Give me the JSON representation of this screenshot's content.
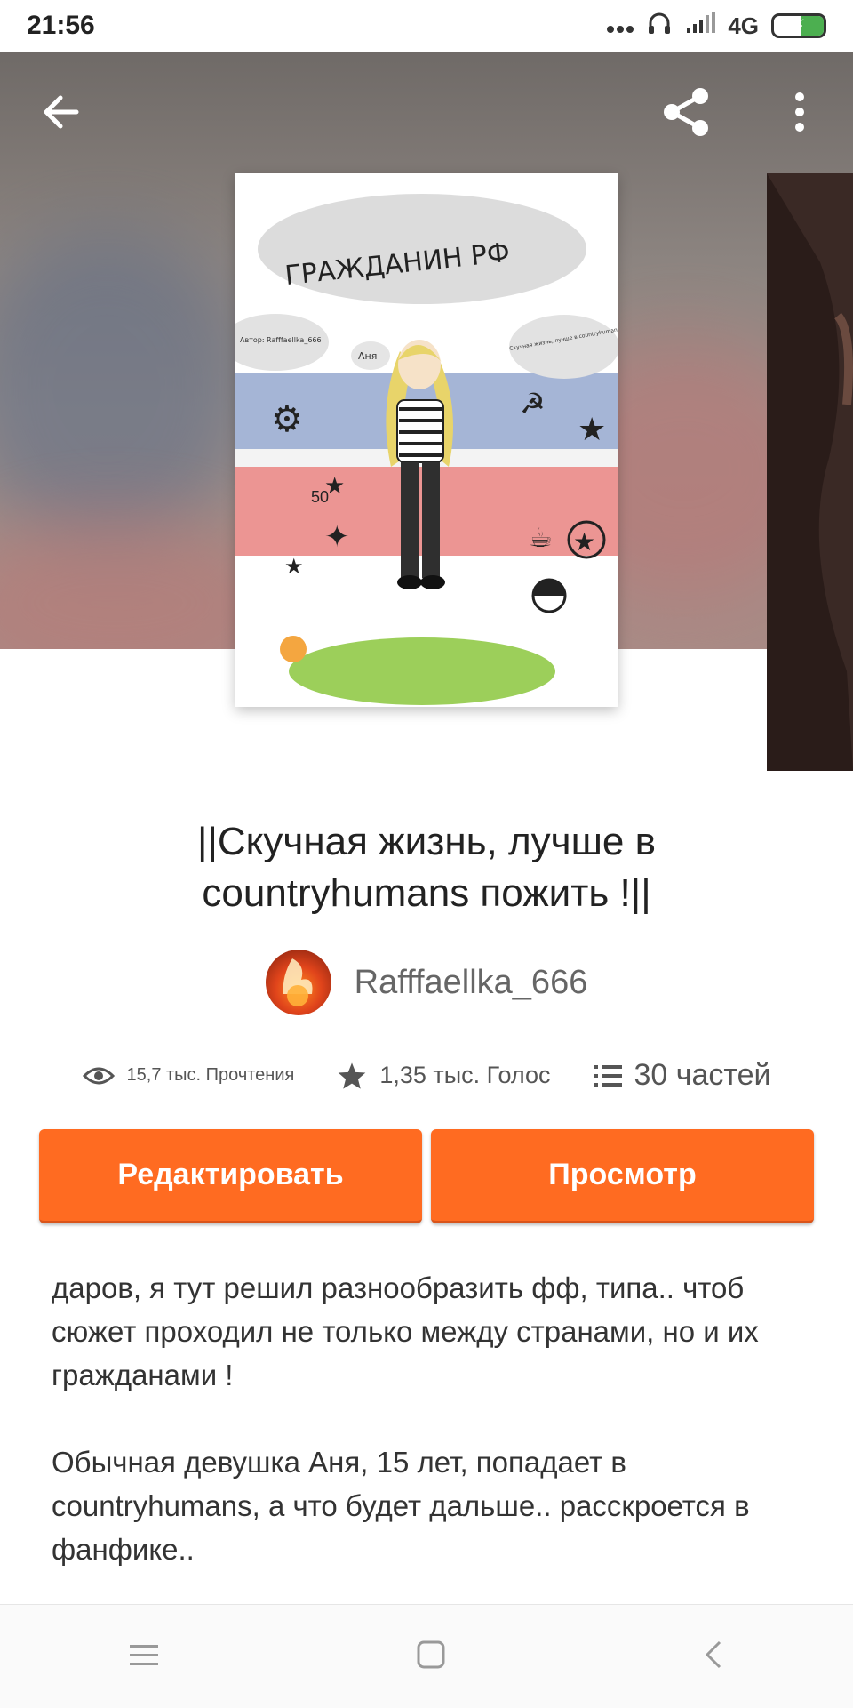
{
  "status_bar": {
    "time": "21:56",
    "signal_label": "4G",
    "icons": [
      "dots-icon",
      "headphones-icon",
      "signal-icon",
      "battery-icon"
    ]
  },
  "top_nav": {
    "back_icon": "arrow-left-icon",
    "share_icon": "share-icon",
    "more_icon": "more-vert-icon"
  },
  "cover": {
    "text_title": "ГРАЖДАНИН РФ",
    "text_author": "Автор: Rafffaellka_666",
    "text_book": "Скучная жизнь, лучше в countryhumans пожить",
    "text_name": "Аня",
    "text_number": "50"
  },
  "story": {
    "title": "||Скучная жизнь, лучше в countryhumans пожить !||",
    "author": "Rafffaellka_666",
    "reads": "15,7 тыс. Прочтения",
    "votes": "1,35 тыс. Голос",
    "parts": "30 частей"
  },
  "buttons": {
    "edit": "Редактировать",
    "preview": "Просмотр"
  },
  "description": {
    "paragraph1": "даров, я тут решил разнообразить фф, типа.. чтоб сюжет проходил не только между странами, но и их гражданами !",
    "paragraph2": "Обычная девушка Аня, 15 лет,  попадает в countryhumans, а что будет дальше.. расскроется в фанфике.."
  },
  "colors": {
    "accent": "#ff6b21",
    "text": "#222222",
    "muted": "#666666"
  },
  "nav_bar": [
    "menu-icon",
    "home-square-icon",
    "back-chevron-icon"
  ]
}
